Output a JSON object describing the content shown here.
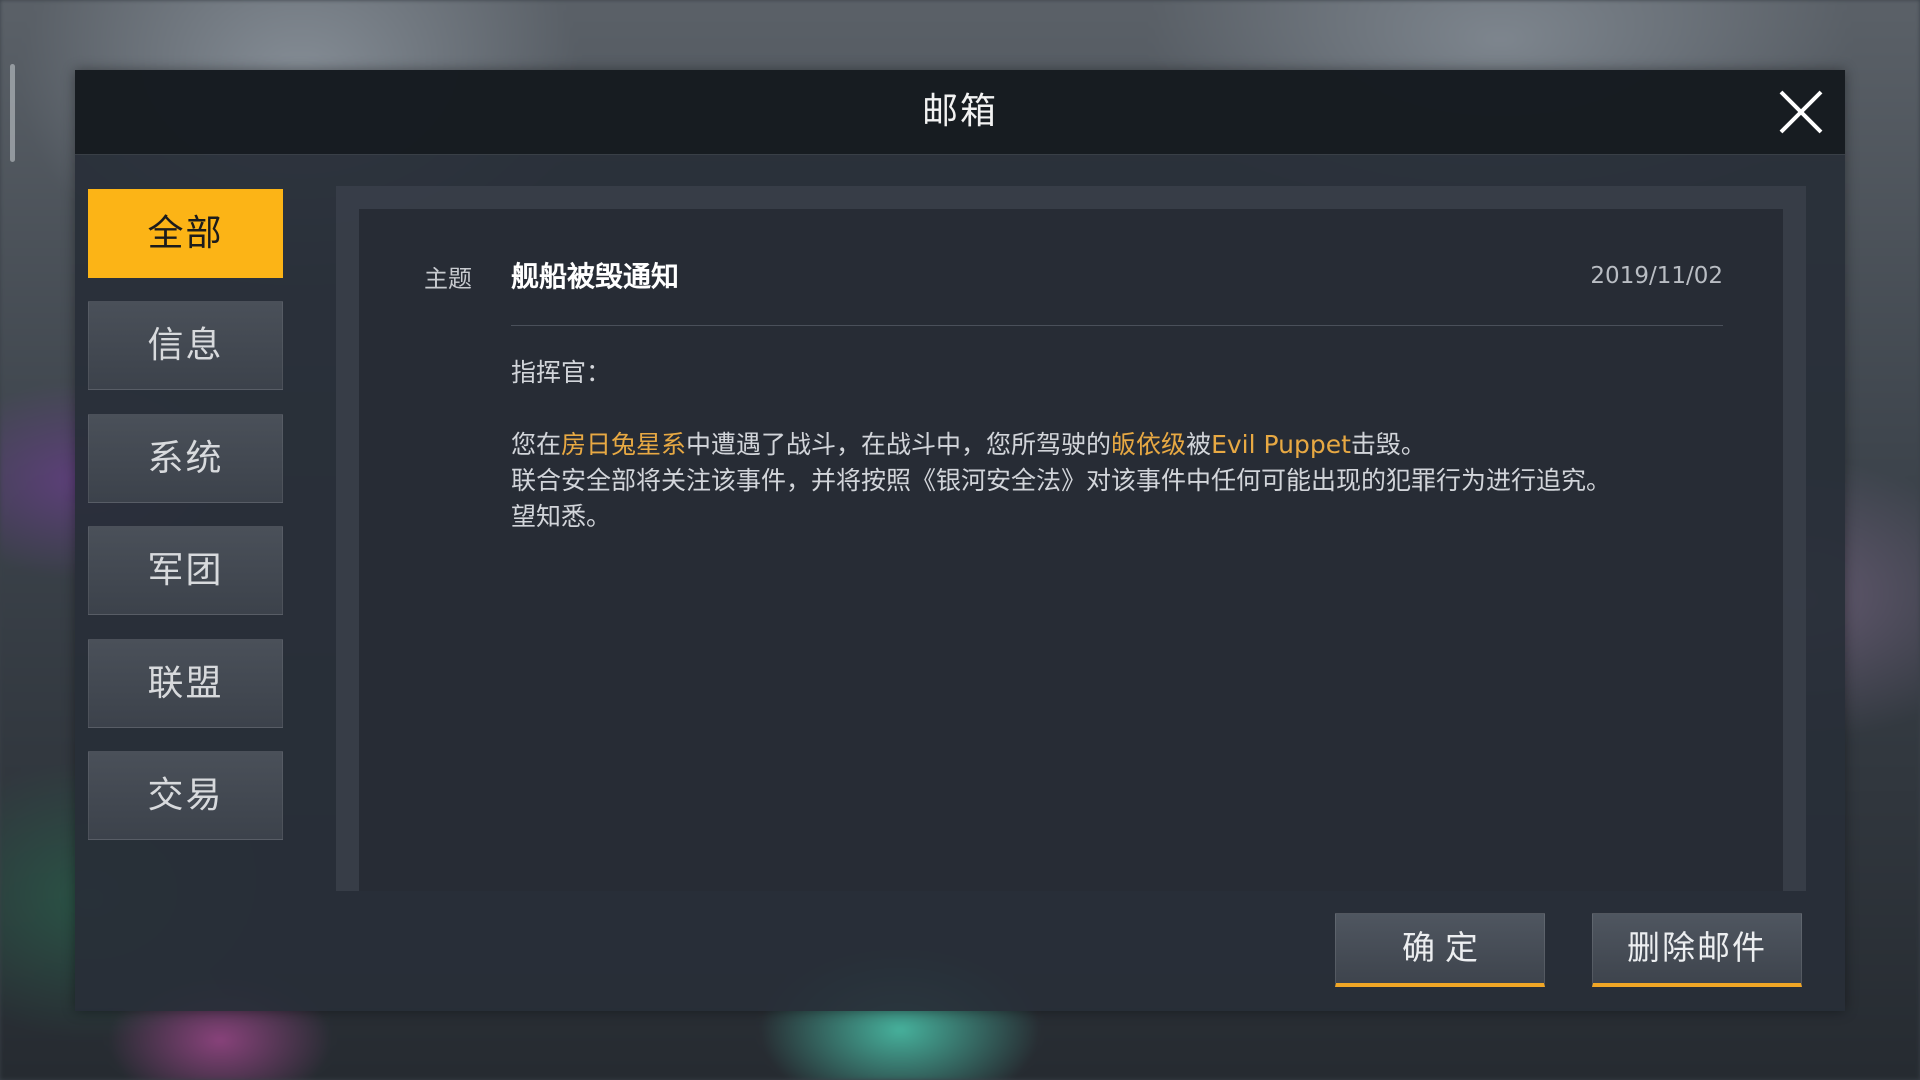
{
  "window": {
    "title": "邮箱",
    "close_icon": "close-icon"
  },
  "sidebar": {
    "tabs": [
      {
        "label": "全部",
        "active": true
      },
      {
        "label": "信息",
        "active": false
      },
      {
        "label": "系统",
        "active": false
      },
      {
        "label": "军团",
        "active": false
      },
      {
        "label": "联盟",
        "active": false
      },
      {
        "label": "交易",
        "active": false
      }
    ]
  },
  "mail": {
    "subject_label": "主题",
    "subject": "舰船被毁通知",
    "date": "2019/11/02",
    "greeting": "指挥官：",
    "line1": {
      "p1": "您在",
      "location": "房日兔星系",
      "p2": "中遭遇了战斗，在战斗中，您所驾驶的",
      "ship": "皈依级",
      "p3": "被",
      "attacker": "Evil Puppet",
      "p4": "击毁。"
    },
    "line2": "联合安全部将关注该事件，并将按照《银河安全法》对该事件中任何可能出现的犯罪行为进行追究。",
    "line3": "望知悉。"
  },
  "buttons": {
    "confirm_label": "确定",
    "delete_label": "删除邮件"
  },
  "colors": {
    "accent": "#fcb416",
    "highlight_text": "#e8a943",
    "panel": "#282e38"
  }
}
